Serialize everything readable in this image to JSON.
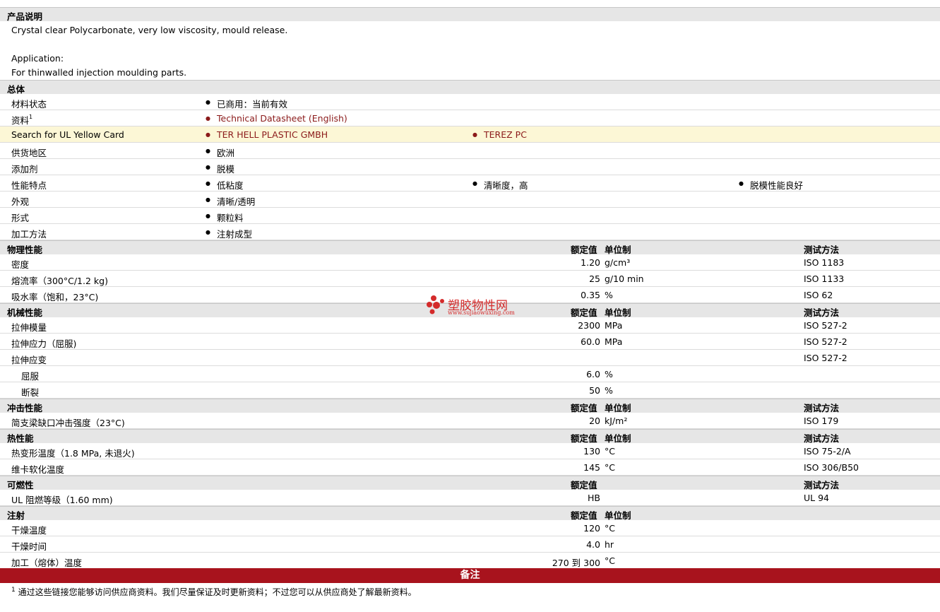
{
  "description": {
    "title": "产品说明",
    "line1": "Crystal clear Polycarbonate, very low viscosity, mould release.",
    "line2": "Application:",
    "line3": "For thinwalled injection moulding parts."
  },
  "general": {
    "title": "总体",
    "status_label": "材料状态",
    "status_value": "已商用：当前有效",
    "info_label": "资料",
    "info_sup": "1",
    "info_link": "Technical Datasheet (English)",
    "ul_label": "Search for UL Yellow Card",
    "ul_link1": "TER HELL PLASTIC GMBH",
    "ul_link2": "TEREZ PC",
    "region_label": "供货地区",
    "region_value": "欧洲",
    "additive_label": "添加剂",
    "additive_value": "脱模",
    "features_label": "性能特点",
    "feature1": "低粘度",
    "feature2": "清晰度，高",
    "feature3": "脱模性能良好",
    "appearance_label": "外观",
    "appearance_value": "清晰/透明",
    "form_label": "形式",
    "form_value": "颗粒料",
    "process_label": "加工方法",
    "process_value": "注射成型"
  },
  "headers": {
    "nominal": "额定值",
    "unit": "单位制",
    "method": "测试方法"
  },
  "physical": {
    "title": "物理性能",
    "rows": [
      {
        "name": "密度",
        "value": "1.20",
        "unit": "g/cm³",
        "method": "ISO 1183"
      },
      {
        "name": "熔流率（300°C/1.2 kg)",
        "value": "25",
        "unit": "g/10 min",
        "method": "ISO 1133"
      },
      {
        "name": "吸水率（饱和，23°C)",
        "value": "0.35",
        "unit": "%",
        "method": "ISO 62"
      }
    ]
  },
  "mechanical": {
    "title": "机械性能",
    "rows": [
      {
        "name": "拉伸模量",
        "value": "2300",
        "unit": "MPa",
        "method": "ISO 527-2"
      },
      {
        "name": "拉伸应力（屈服)",
        "value": "60.0",
        "unit": "MPa",
        "method": "ISO 527-2"
      },
      {
        "name": "拉伸应变",
        "value": "",
        "unit": "",
        "method": "ISO 527-2"
      },
      {
        "name": "屈服",
        "value": "6.0",
        "unit": "%",
        "method": ""
      },
      {
        "name": "断裂",
        "value": "50",
        "unit": "%",
        "method": ""
      }
    ]
  },
  "impact": {
    "title": "冲击性能",
    "rows": [
      {
        "name": "简支梁缺口冲击强度（23°C)",
        "value": "20",
        "unit": "kJ/m²",
        "method": "ISO 179"
      }
    ]
  },
  "thermal": {
    "title": "热性能",
    "rows": [
      {
        "name": "热变形温度（1.8 MPa, 未退火)",
        "value": "130",
        "unit": "°C",
        "method": "ISO 75-2/A"
      },
      {
        "name": "维卡软化温度",
        "value": "145",
        "unit": "°C",
        "method": "ISO 306/B50"
      }
    ]
  },
  "flammability": {
    "title": "可燃性",
    "rows": [
      {
        "name": "UL 阻燃等级（1.60 mm)",
        "value": "HB",
        "unit": "",
        "method": "UL 94"
      }
    ]
  },
  "injection": {
    "title": "注射",
    "rows": [
      {
        "name": "干燥温度",
        "value": "120",
        "unit": "°C",
        "method": ""
      },
      {
        "name": "干燥时间",
        "value": "4.0",
        "unit": "hr",
        "method": ""
      },
      {
        "name": "加工（熔体）温度",
        "value": "270 到  300",
        "unit": "°C",
        "method": ""
      }
    ]
  },
  "notes": {
    "title": "备注",
    "sup": "1",
    "text": "通过这些链接您能够访问供应商资料。我们尽量保证及时更新资料；不过您可以从供应商处了解最新资料。"
  },
  "watermark": {
    "name": "塑胶物性网",
    "url": "www.sujiaowuxing.com"
  },
  "colors": {
    "header_bg": "#e6e6e6",
    "highlight_bg": "#fcf7d6",
    "link": "#8b1a1a",
    "notes_bar": "#a8131d",
    "watermark": "#d42b2b"
  }
}
